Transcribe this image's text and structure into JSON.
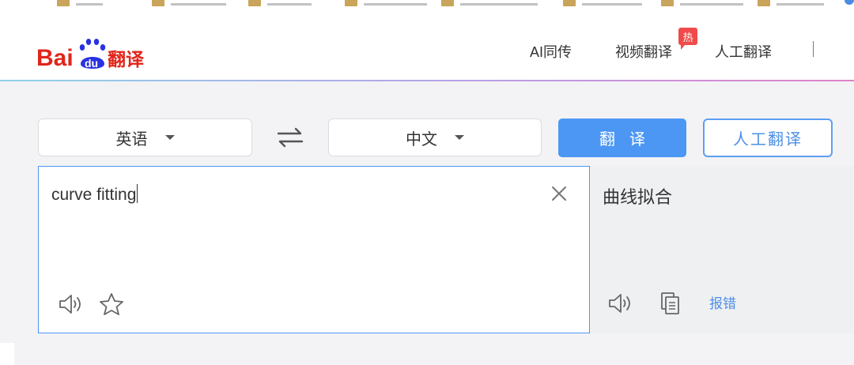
{
  "header": {
    "logo_text_bai": "Bai",
    "logo_text_du": "du",
    "logo_text_product": "翻译",
    "nav": [
      {
        "label": "AI同传"
      },
      {
        "label": "视频翻译",
        "badge": "热"
      },
      {
        "label": "人工翻译"
      }
    ]
  },
  "lang_bar": {
    "source_lang": "英语",
    "target_lang": "中文",
    "translate_label": "翻译",
    "human_translate_label": "人工翻译"
  },
  "input": {
    "value": "curve fitting"
  },
  "output": {
    "value": "曲线拟合",
    "report_label": "报错"
  },
  "colors": {
    "accent": "#4d97f4",
    "logo_red": "#e1251b",
    "logo_blue": "#2932e1",
    "hot_badge": "#f04a4a"
  },
  "icons": [
    "swap-languages-icon",
    "clear-icon",
    "speaker-icon",
    "star-icon",
    "copy-icon"
  ]
}
